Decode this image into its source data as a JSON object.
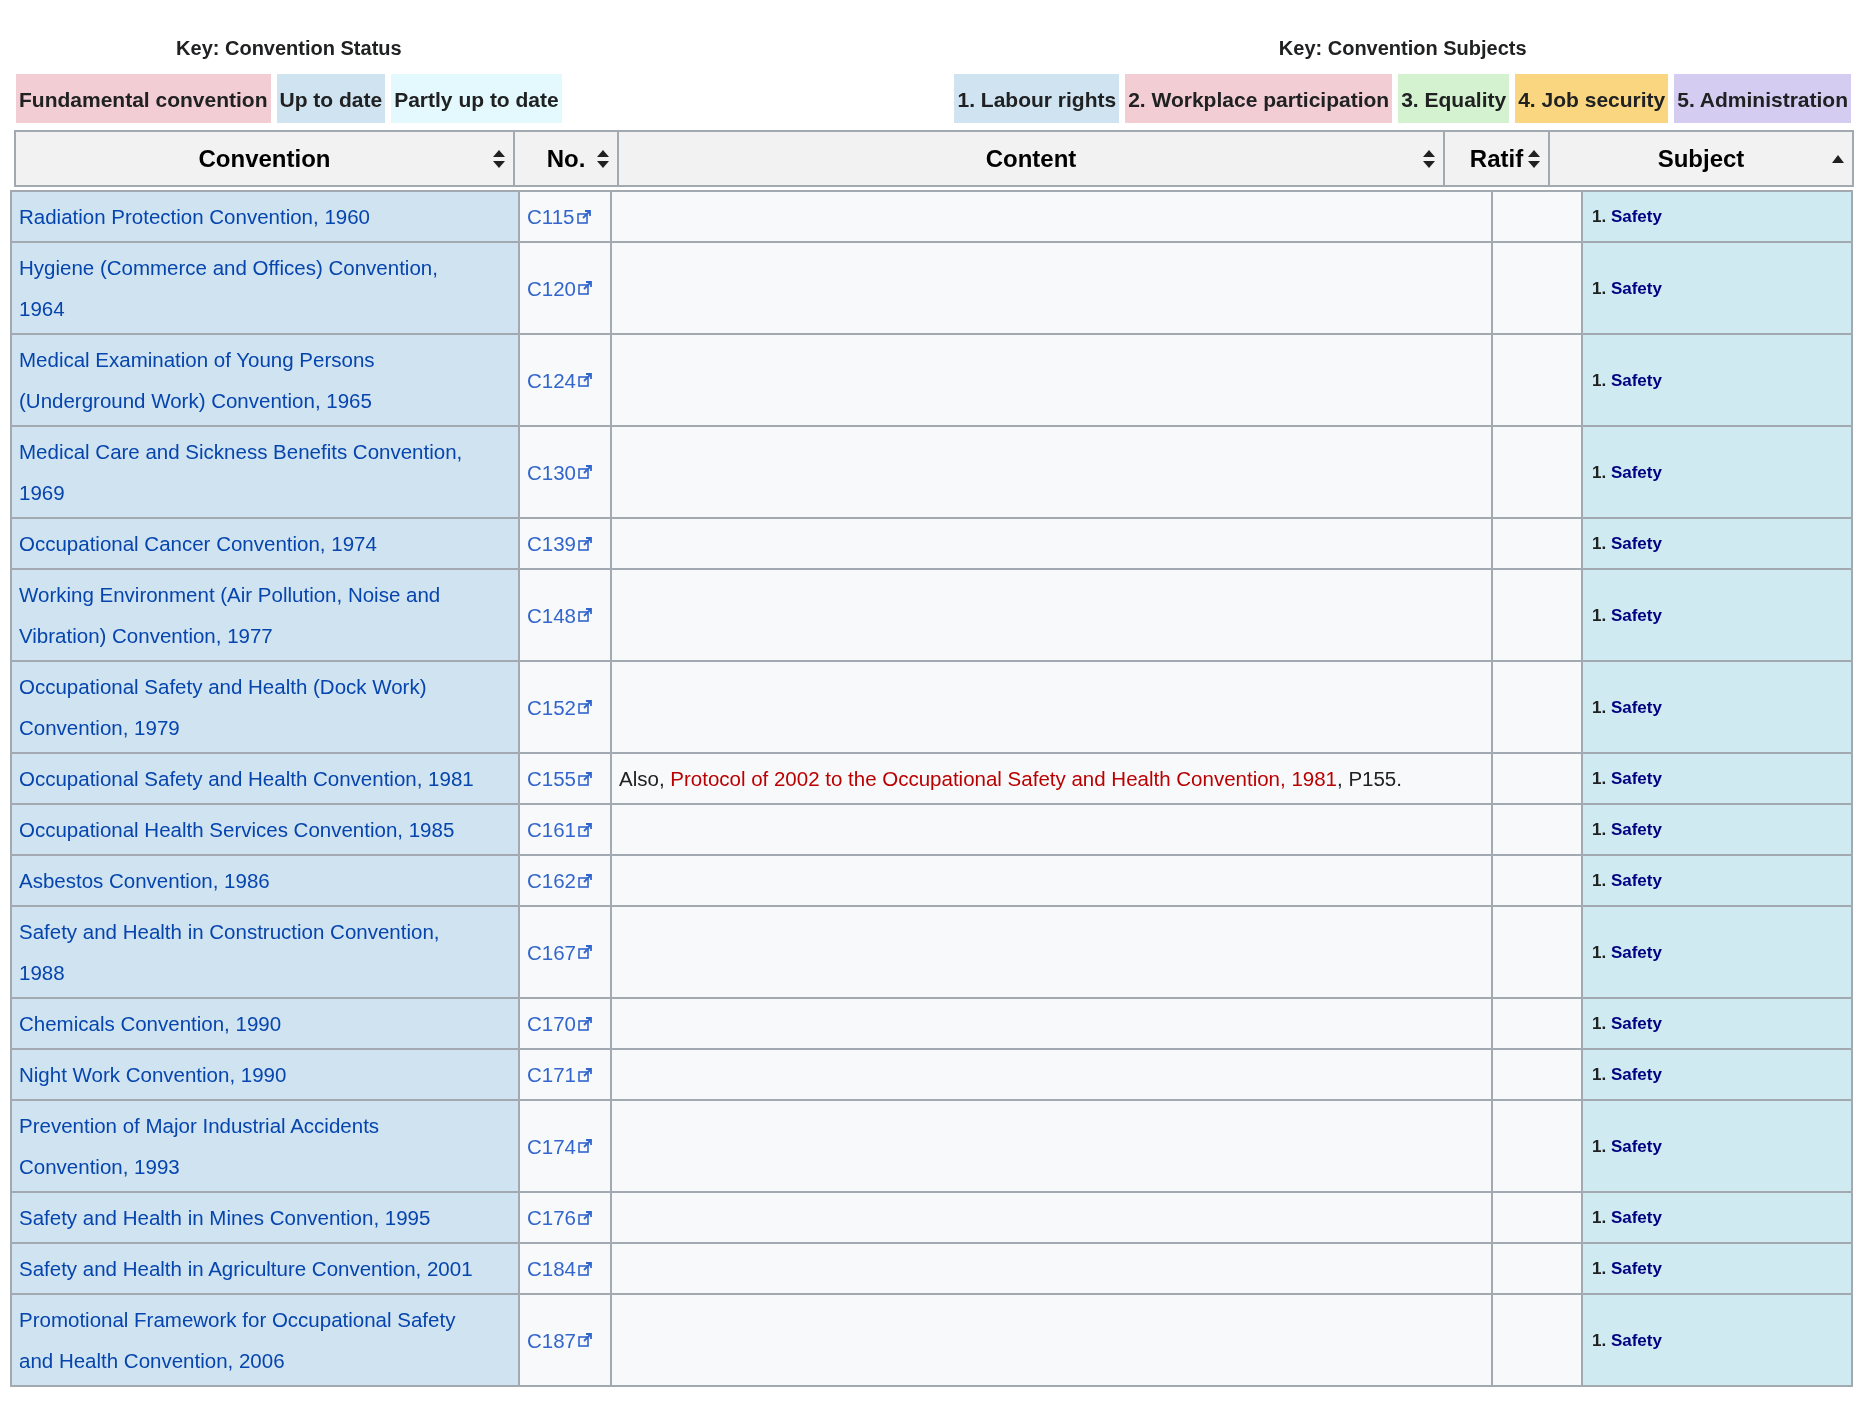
{
  "status_key": {
    "title": "Key: Convention Status",
    "items": [
      {
        "label": "Fundamental convention",
        "color": "#f2cdd4"
      },
      {
        "label": "Up to date",
        "color": "#cfe3f0"
      },
      {
        "label": "Partly up to date",
        "color": "#e3f9fd"
      }
    ]
  },
  "subject_key": {
    "title": "Key: Convention Subjects",
    "items": [
      {
        "label": "1. Labour rights",
        "color": "#cfe3f0"
      },
      {
        "label": "2. Workplace participation",
        "color": "#f2cdd4"
      },
      {
        "label": "3. Equality",
        "color": "#d5f2d0"
      },
      {
        "label": "4. Job security",
        "color": "#f9d67f"
      },
      {
        "label": "5. Administration",
        "color": "#d5cdf1"
      }
    ]
  },
  "table": {
    "columns": [
      {
        "label": "Convention",
        "sorted": false
      },
      {
        "label": "No.",
        "sorted": false
      },
      {
        "label": "Content",
        "sorted": false
      },
      {
        "label": "Ratif",
        "sorted": false
      },
      {
        "label": "Subject",
        "sorted": true
      }
    ],
    "rows": [
      {
        "convention": "Radiation Protection Convention, 1960",
        "number": "C115",
        "color": "#cfe3f0",
        "subject_number": "1.",
        "subject": "Safety"
      },
      {
        "convention": "Hygiene (Commerce and Offices) Convention, 1964",
        "number": "C120",
        "color": "#cfe3f0",
        "subject_number": "1.",
        "subject": "Safety"
      },
      {
        "convention": "Medical Examination of Young Persons (Underground Work) Convention, 1965",
        "number": "C124",
        "color": "#cfe3f0",
        "subject_number": "1.",
        "subject": "Safety"
      },
      {
        "convention": "Medical Care and Sickness Benefits Convention, 1969",
        "number": "C130",
        "color": "#cfe3f0",
        "subject_number": "1.",
        "subject": "Safety"
      },
      {
        "convention": "Occupational Cancer Convention, 1974",
        "number": "C139",
        "color": "#cfe3f0",
        "subject_number": "1.",
        "subject": "Safety"
      },
      {
        "convention": "Working Environment (Air Pollution, Noise and Vibration) Convention, 1977",
        "number": "C148",
        "color": "#cfe3f0",
        "subject_number": "1.",
        "subject": "Safety"
      },
      {
        "convention": "Occupational Safety and Health (Dock Work) Convention, 1979",
        "number": "C152",
        "color": "#cfe3f0",
        "subject_number": "1.",
        "subject": "Safety"
      },
      {
        "convention": "Occupational Safety and Health Convention, 1981",
        "number": "C155",
        "color": "#cfe3f0",
        "content": [
          {
            "kind": "text",
            "text": "Also, "
          },
          {
            "kind": "link",
            "text": "Protocol of 2002 to the Occupational Safety and Health Convention, 1981"
          },
          {
            "kind": "text",
            "text": ", P155."
          }
        ],
        "subject_number": "1.",
        "subject": "Safety"
      },
      {
        "convention": "Occupational Health Services Convention, 1985",
        "number": "C161",
        "color": "#cfe3f0",
        "subject_number": "1.",
        "subject": "Safety"
      },
      {
        "convention": "Asbestos Convention, 1986",
        "number": "C162",
        "color": "#cfe3f0",
        "subject_number": "1.",
        "subject": "Safety"
      },
      {
        "convention": "Safety and Health in Construction Convention, 1988",
        "number": "C167",
        "color": "#cfe3f0",
        "subject_number": "1.",
        "subject": "Safety"
      },
      {
        "convention": "Chemicals Convention, 1990",
        "number": "C170",
        "color": "#cfe3f0",
        "subject_number": "1.",
        "subject": "Safety"
      },
      {
        "convention": "Night Work Convention, 1990",
        "number": "C171",
        "color": "#cfe3f0",
        "subject_number": "1.",
        "subject": "Safety"
      },
      {
        "convention": "Prevention of Major Industrial Accidents Convention, 1993",
        "number": "C174",
        "color": "#cfe3f0",
        "subject_number": "1.",
        "subject": "Safety"
      },
      {
        "convention": "Safety and Health in Mines Convention, 1995",
        "number": "C176",
        "color": "#cfe3f0",
        "subject_number": "1.",
        "subject": "Safety"
      },
      {
        "convention": "Safety and Health in Agriculture Convention, 2001",
        "number": "C184",
        "color": "#cfe3f0",
        "subject_number": "1.",
        "subject": "Safety"
      },
      {
        "convention": "Promotional Framework for Occupational Safety and Health Convention, 2006",
        "number": "C187",
        "color": "#cfe3f0",
        "subject_number": "1.",
        "subject": "Safety"
      }
    ]
  }
}
